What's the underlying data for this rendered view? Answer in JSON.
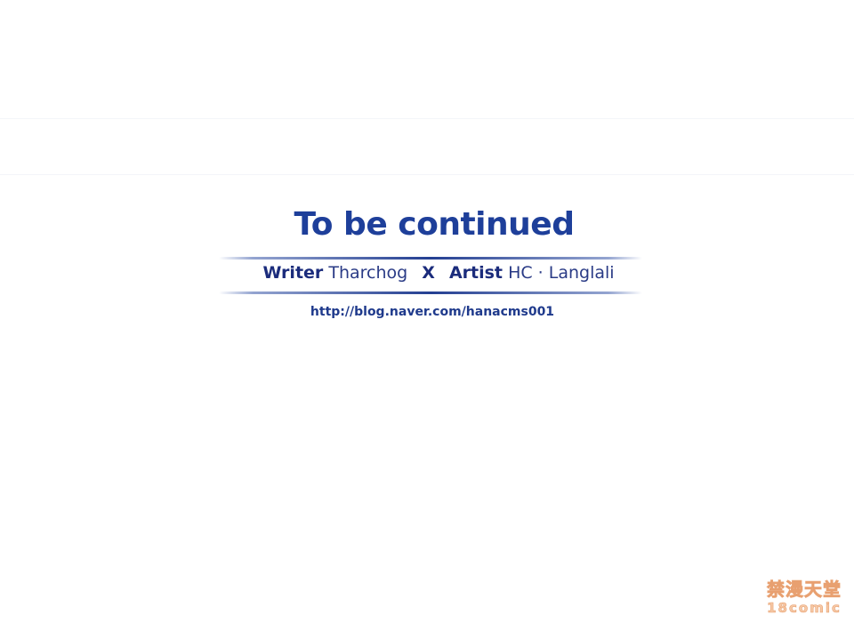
{
  "end_card": {
    "title": "To be continued",
    "credits": {
      "writer_label": "Writer",
      "writer_name": "Tharchog",
      "separator": "X",
      "artist_label": "Artist",
      "artist_name": "HC · Langlali"
    },
    "url": "http://blog.naver.com/hanacms001"
  },
  "watermark": {
    "chinese": "禁漫天堂",
    "latin": "18comic"
  },
  "colors": {
    "title": "#1e3f9a",
    "credits": "#1c2f7e",
    "rule": "#243f92",
    "watermark": "#f6c9a7"
  }
}
